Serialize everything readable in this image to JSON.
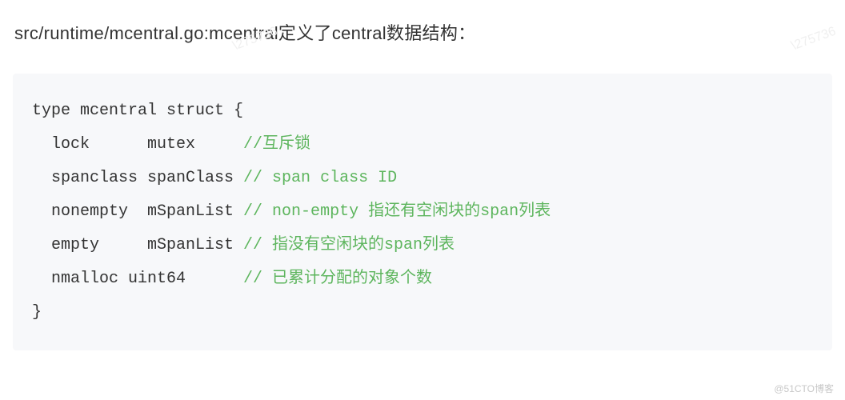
{
  "heading": "src/runtime/mcentral.go:mcentral定义了central数据结构：",
  "watermark": "\\275736",
  "code": {
    "l1": "type mcentral struct {",
    "l2a": "  lock      mutex     ",
    "l2b": "//互斥锁",
    "l3a": "  spanclass spanClass ",
    "l3b": "// span class ID",
    "l4a": "  nonempty  mSpanList ",
    "l4b": "// non-empty 指还有空闲块的span列表",
    "l5a": "  empty     mSpanList ",
    "l5b": "// 指没有空闲块的span列表",
    "l6a": "  nmalloc uint64      ",
    "l6b": "// 已累计分配的对象个数",
    "l7": "}"
  },
  "attribution": "@51CTO博客"
}
